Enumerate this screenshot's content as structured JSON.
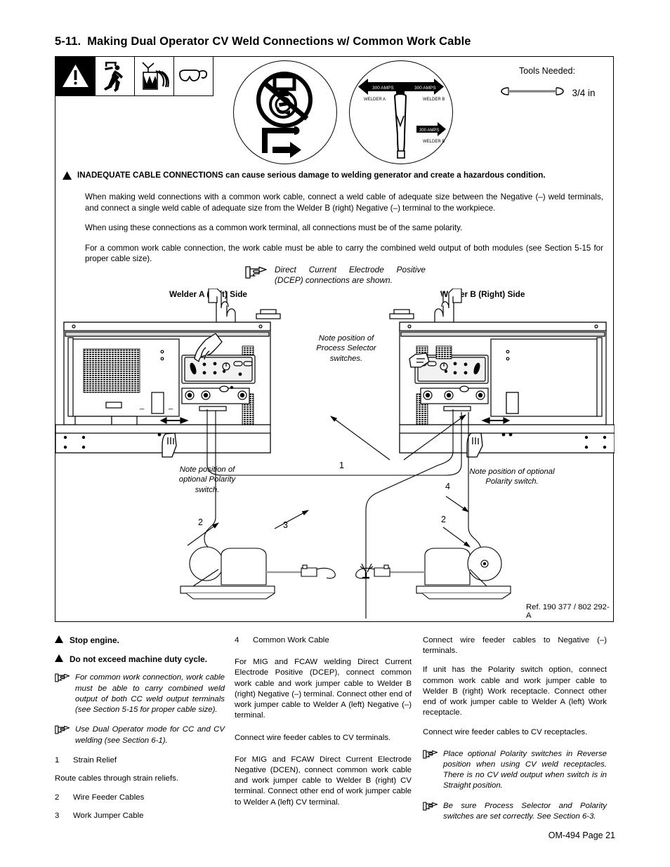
{
  "section": {
    "number": "5-11.",
    "title": "Making Dual Operator CV Weld Connections w/ Common Work Cable"
  },
  "safety_icons": [
    {
      "name": "warning-triangle-icon",
      "label": "warning"
    },
    {
      "name": "electric-shock-icon",
      "label": "electric shock"
    },
    {
      "name": "arc-rays-fire-icon",
      "label": "arc rays / fire"
    },
    {
      "name": "eye-protection-icon",
      "label": "wear eye protection"
    }
  ],
  "illustrations": {
    "no_parallel": {
      "name": "no-parallel-connection-icon"
    },
    "amps": {
      "name": "dual-operator-amps-icon",
      "left_arrow_label": "300 AMPS",
      "left_sub_label": "WELDER A",
      "right_arrow_label": "300 AMPS",
      "right_sub_label": "WELDER B",
      "lower_arrow_label": "300 AMPS",
      "lower_sub_label": "WELDER B"
    }
  },
  "tools": {
    "label": "Tools Needed:",
    "wrench_size": "3/4 in"
  },
  "warning": {
    "headline_bold": "INADEQUATE CABLE CONNECTIONS",
    "headline_rest": " can cause serious damage to welding generator and create a hazardous condition.",
    "paragraphs": [
      "When making weld connections with a common work cable, connect a weld cable of adequate size between the Negative (–) weld terminals, and connect a single weld cable of adequate size from the Welder B (right) Negative (–) terminal to the workpiece.",
      "When using these connections as a common work terminal, all connections must be of the same polarity.",
      "For a common work cable connection, the work cable must be able to carry the combined weld output of both modules (see Section 5-15 for proper cable size)."
    ]
  },
  "diagram": {
    "dcep_note": "Direct Current Electrode Positive (DCEP) connections are shown.",
    "welder_a_label": "Welder A (Left) Side",
    "welder_b_label": "Welder B (Right) Side",
    "note_process_selector": "Note position of Process Selector switches.",
    "note_polarity_left": "Note position of optional Polarity switch.",
    "note_polarity_right": "Note position of optional Polarity switch.",
    "callouts": {
      "one": "1",
      "two_left": "2",
      "two_right": "2",
      "three": "3",
      "four": "4"
    },
    "reference": "Ref. 190 377 / 802 292-A"
  },
  "columns": {
    "left": {
      "stop_engine": "Stop engine.",
      "duty_cycle": "Do not exceed machine duty cycle.",
      "hand_note_1": "For common work connection, work cable must be able to carry combined weld output of both CC weld output terminals (see Section 5-15 for proper cable size).",
      "hand_note_2": "Use Dual Operator mode for CC and CV welding (see Section 6-1).",
      "item_1_num": "1",
      "item_1_text": "Strain Relief",
      "route_text": "Route cables through strain reliefs.",
      "item_2_num": "2",
      "item_2_text": "Wire Feeder Cables",
      "item_3_num": "3",
      "item_3_text": "Work Jumper Cable"
    },
    "middle": {
      "item_4_num": "4",
      "item_4_text": "Common Work Cable",
      "para_1": "For MIG and FCAW welding Direct Current Electrode Positive (DCEP), connect common work cable and work jumper cable to Welder B (right) Negative (–) terminal. Connect other end of work jumper cable to Welder A (left) Negative (–) terminal.",
      "para_2": "Connect wire feeder cables to CV terminals.",
      "para_3": "For MIG and FCAW Direct Current Electrode Negative (DCEN), connect common work cable and work jumper cable to Welder B (right) CV terminal. Connect other end of work jumper cable to Welder A (left) CV terminal."
    },
    "right": {
      "para_1": "Connect wire feeder cables to Negative (–) terminals.",
      "para_2": "If unit has the Polarity switch option, connect common work cable and work jumper cable to Welder B (right)  Work receptacle. Connect other end of work jumper cable to Welder A (left) Work receptacle.",
      "para_3": "Connect wire feeder cables to CV receptacles.",
      "hand_note_1": "Place optional Polarity switches in Reverse position when using CV weld receptacles. There is no CV weld output when switch is in Straight position.",
      "hand_note_2": "Be sure Process Selector and Polarity switches are set correctly. See Section 6-3."
    }
  },
  "footer": "OM-494 Page 21"
}
